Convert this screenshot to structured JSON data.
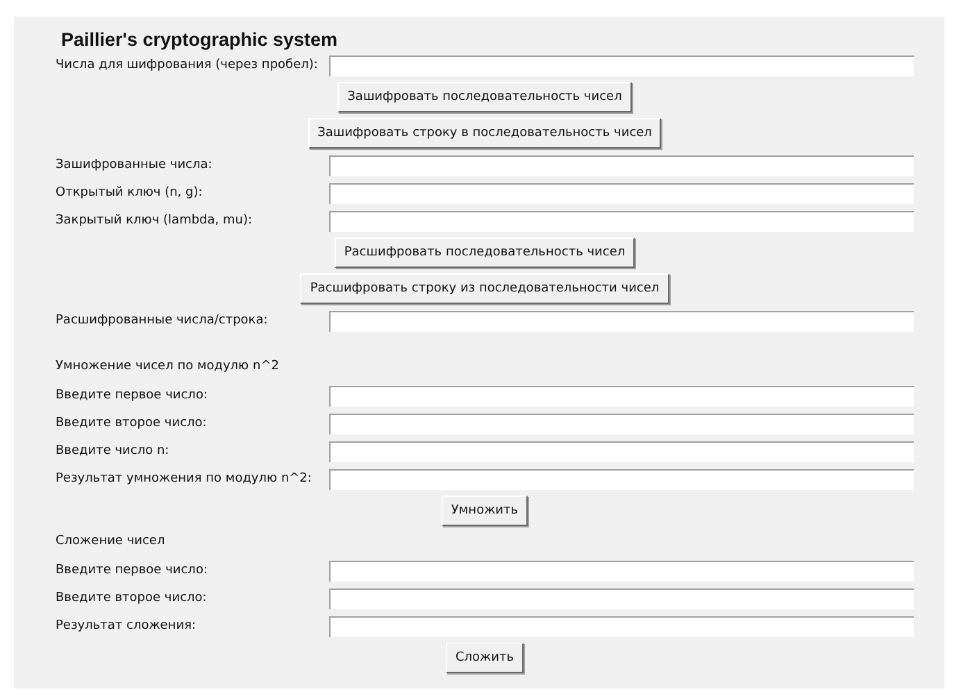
{
  "title": "Paillier's cryptographic system",
  "rows": [
    {
      "kind": "field",
      "label": "Числа для шифрования (через пробел):"
    },
    {
      "kind": "button",
      "label": "Зашифровать последовательность чисел"
    },
    {
      "kind": "button",
      "label": "Зашифровать строку в последовательность чисел"
    },
    {
      "kind": "field",
      "label": "Зашифрованные числа:"
    },
    {
      "kind": "field",
      "label": "Открытый ключ (n, g):"
    },
    {
      "kind": "field",
      "label": "Закрытый ключ (lambda, mu):"
    },
    {
      "kind": "button",
      "label": "Расшифровать последовательность чисел"
    },
    {
      "kind": "button",
      "label": "Расшифровать строку из последовательности чисел"
    },
    {
      "kind": "field",
      "label": "Расшифрованные числа/строка:"
    },
    {
      "kind": "spacer"
    },
    {
      "kind": "heading",
      "label": "Умножение чисел по модулю n^2"
    },
    {
      "kind": "field",
      "label": "Введите первое число:"
    },
    {
      "kind": "field",
      "label": "Введите второе число:"
    },
    {
      "kind": "field",
      "label": "Введите число n:"
    },
    {
      "kind": "field",
      "label": "Результат умножения по модулю n^2:"
    },
    {
      "kind": "button",
      "label": "Умножить"
    },
    {
      "kind": "heading",
      "label": "Сложение чисел"
    },
    {
      "kind": "field",
      "label": "Введите первое число:"
    },
    {
      "kind": "field",
      "label": "Введите второе число:"
    },
    {
      "kind": "field",
      "label": "Результат сложения:"
    },
    {
      "kind": "button",
      "label": "Сложить"
    }
  ]
}
